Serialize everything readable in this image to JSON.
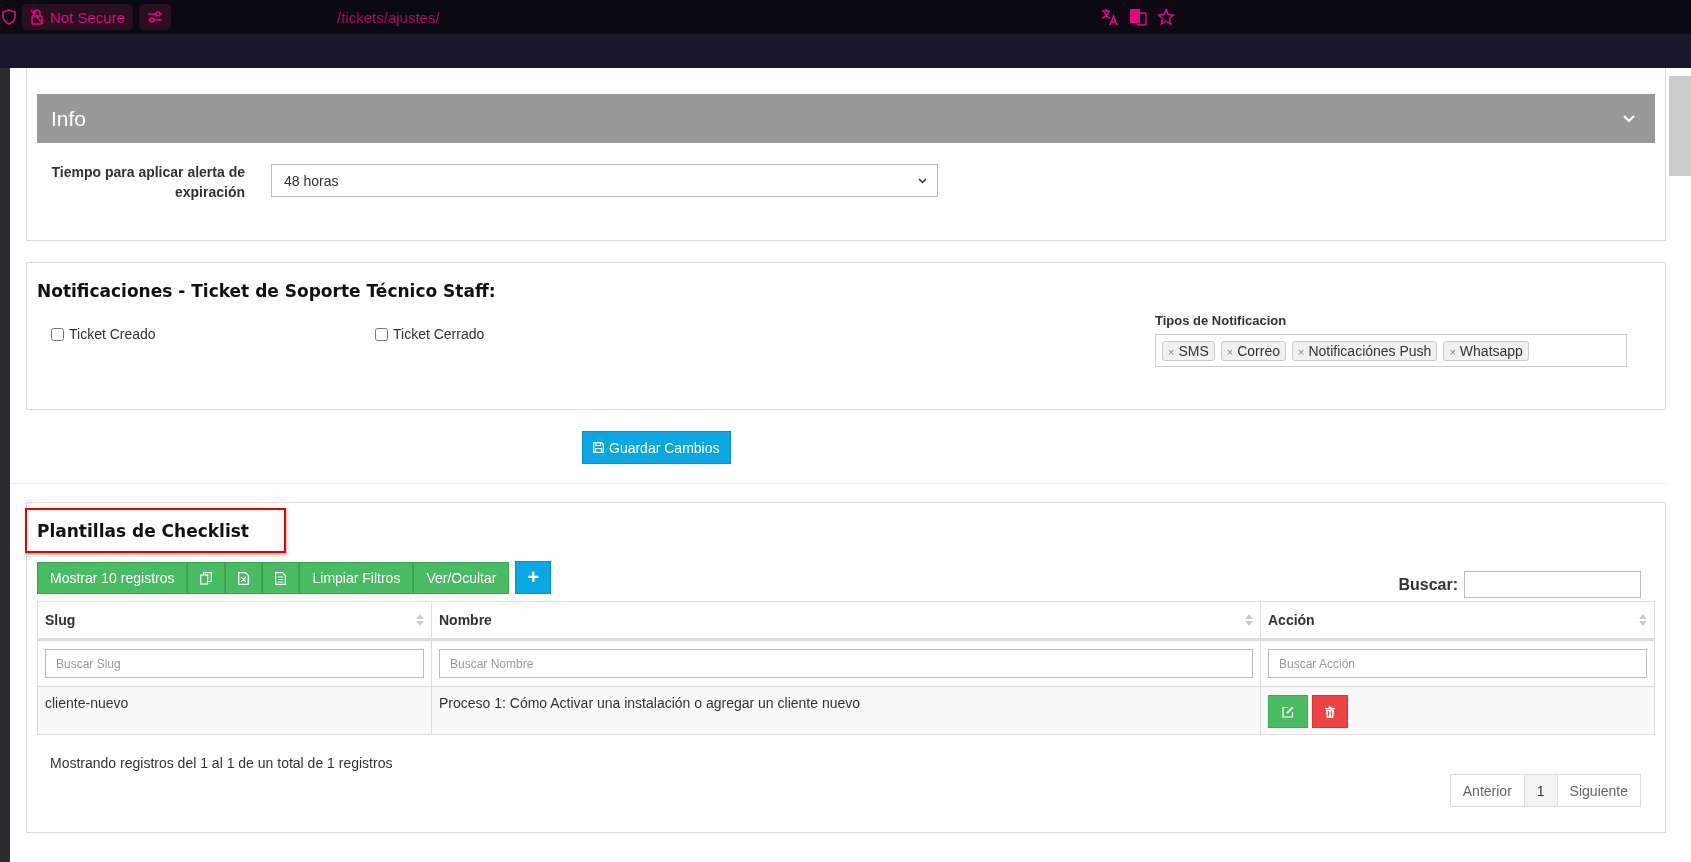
{
  "browser": {
    "security": "Not Secure",
    "url": "/tickets/ajustes/"
  },
  "info": {
    "title": "Info",
    "fields": [
      {
        "label": "Tiempo para aplicar alerta de expiración",
        "value": "48 horas"
      }
    ]
  },
  "notifications": {
    "title": "Notificaciones - Ticket de Soporte Técnico Staff:",
    "options": [
      {
        "label": "Ticket Creado",
        "checked": false
      },
      {
        "label": "Ticket Cerrado",
        "checked": false
      }
    ],
    "types_label": "Tipos de Notificacion",
    "types": [
      {
        "remove": "×",
        "label": "SMS"
      },
      {
        "remove": "×",
        "label": "Correo"
      },
      {
        "remove": "×",
        "label": "Notificaciónes Push"
      },
      {
        "remove": "×",
        "label": "Whatsapp"
      }
    ]
  },
  "save_button": "Guardar Cambios",
  "checklist": {
    "title": "Plantillas de Checklist",
    "toolbar": {
      "show": "Mostrar 10 registros",
      "buttons": [
        "Limpiar Filtros",
        "Ver/Ocultar"
      ],
      "add": "+"
    },
    "search_label": "Buscar:",
    "columns": [
      {
        "label": "Slug",
        "filter_placeholder": "Buscar Slug"
      },
      {
        "label": "Nombre",
        "filter_placeholder": "Buscar Nombre"
      },
      {
        "label": "Acción",
        "filter_placeholder": "Buscar Acción"
      }
    ],
    "rows": [
      {
        "cells": [
          "cliente-nuevo",
          "Proceso 1: Cómo Activar una instalación o agregar un cliente nuevo"
        ]
      }
    ],
    "info": "Mostrando registros del 1 al 1 de un total de 1 registros",
    "pagination": [
      {
        "label": "Anterior",
        "selected": false
      },
      {
        "label": "1",
        "selected": true
      },
      {
        "label": "Siguiente",
        "selected": false
      }
    ]
  }
}
